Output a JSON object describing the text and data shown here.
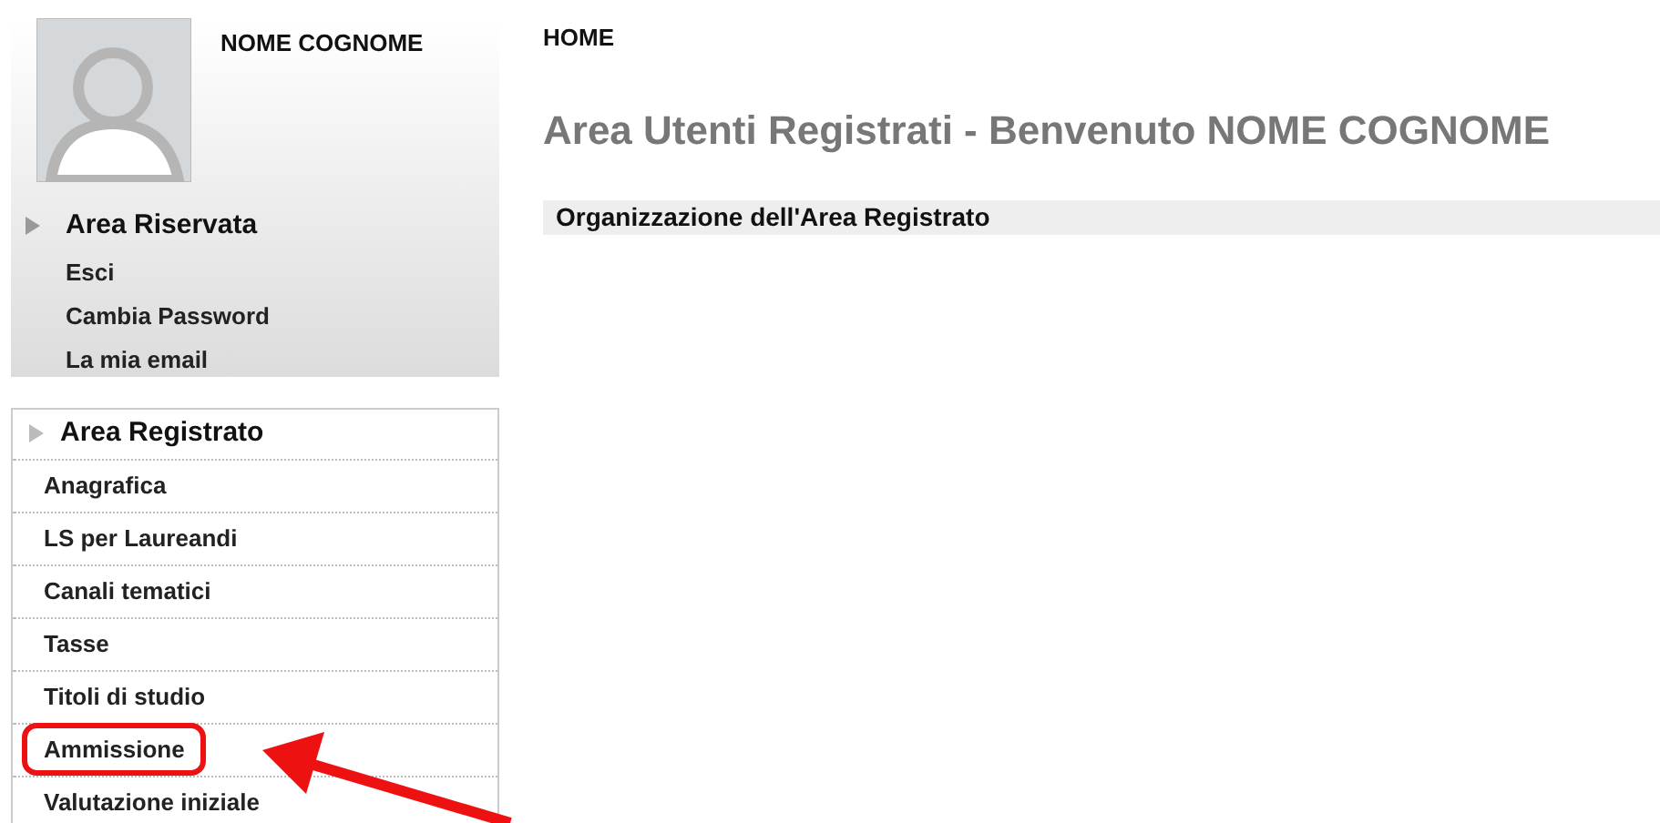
{
  "profile": {
    "name": "NOME COGNOME",
    "section_title": "Area Riservata",
    "links": [
      "Esci",
      "Cambia Password",
      "La mia email"
    ]
  },
  "menu": {
    "title": "Area Registrato",
    "items": [
      {
        "label": "Anagrafica",
        "highlighted": false
      },
      {
        "label": "LS per Laureandi",
        "highlighted": false
      },
      {
        "label": "Canali tematici",
        "highlighted": false
      },
      {
        "label": "Tasse",
        "highlighted": false
      },
      {
        "label": "Titoli di studio",
        "highlighted": false
      },
      {
        "label": "Ammissione",
        "highlighted": true
      },
      {
        "label": "Valutazione iniziale",
        "highlighted": false
      }
    ]
  },
  "breadcrumb": "HOME",
  "page_title": "Area Utenti Registrati - Benvenuto NOME COGNOME",
  "section_heading": "Organizzazione dell'Area Registrato"
}
